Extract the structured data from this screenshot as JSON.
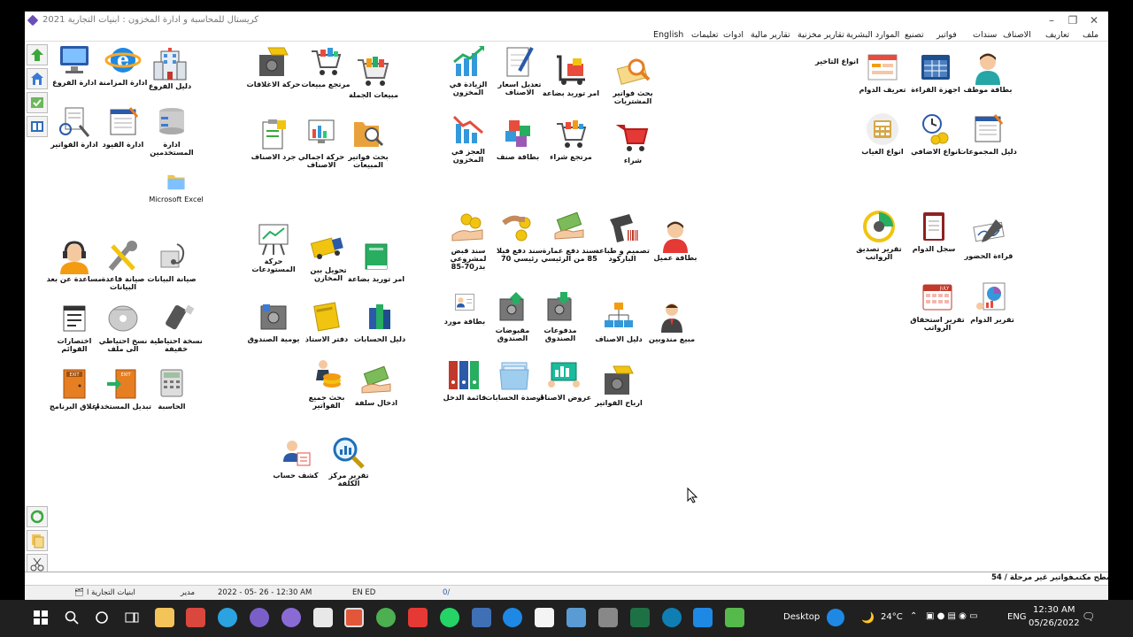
{
  "window": {
    "title": "كريستال للمحاسبة و ادارة المخزون : ابنيات التجارية 2021"
  },
  "menubar": {
    "items": [
      "ملف",
      "تعاريف",
      "الاصناف",
      "سندات",
      "فواتير",
      "تصنيع",
      "الموارد البشرية",
      "تقارير مخزنية",
      "تقارير مالية",
      "ادوات",
      "تعليمات",
      "English"
    ]
  },
  "shortcuts": {
    "admin": [
      {
        "label": "ادارة الفروع",
        "icon": "monitor-icon"
      },
      {
        "label": "ادارة المزامنة",
        "icon": "ie-icon"
      },
      {
        "label": "دليل الفروع",
        "icon": "building-icon"
      },
      {
        "label": "ادارة الفواتير",
        "icon": "invoice-tools-icon"
      },
      {
        "label": "ادارة القيود",
        "icon": "ledger-icon"
      },
      {
        "label": "ادارة المستخدمين",
        "icon": "users-db-icon"
      },
      {
        "label": "Microsoft Excel",
        "icon": "folder-icon"
      }
    ],
    "sales": [
      {
        "label": "حركة الاغلاقات",
        "icon": "safe-gold-icon"
      },
      {
        "label": "مرتجع مبيعات",
        "icon": "cart-return-icon"
      },
      {
        "label": "مبيعات الجملة",
        "icon": "cart-full-icon"
      },
      {
        "label": "جرد الاصناف",
        "icon": "clipboard-icon"
      },
      {
        "label": "حركة اجمالي الاصناف",
        "icon": "monitor-chart-icon"
      },
      {
        "label": "بحث فواتير المبيعات",
        "icon": "folder-search-icon"
      }
    ],
    "purchases": [
      {
        "label": "الزيادة في المخزون",
        "icon": "chart-up-icon"
      },
      {
        "label": "تعديل اسعار الاصناف",
        "icon": "pen-doc-icon"
      },
      {
        "label": "امر توريد بضاعة",
        "icon": "forklift-icon"
      },
      {
        "label": "بحث فواتير المشتريات",
        "icon": "search-doc-icon"
      },
      {
        "label": "العجز في المخزون",
        "icon": "chart-down-icon"
      },
      {
        "label": "بطاقة صنف",
        "icon": "cubes-icon"
      },
      {
        "label": "مرتجع شراء",
        "icon": "cart-return-icon"
      },
      {
        "label": "شراء",
        "icon": "cart-red-icon"
      }
    ],
    "hr": [
      {
        "label": "تعريف الدوام",
        "icon": "schedule-icon"
      },
      {
        "label": "اجهزة القراءة",
        "icon": "calendar-grid-icon"
      },
      {
        "label": "بطاقة موظف",
        "icon": "employee-icon"
      },
      {
        "label": "انواع الغياب",
        "icon": "calculator-icon"
      },
      {
        "label": "انواع الاضافي",
        "icon": "clock-coins-icon"
      },
      {
        "label": "دليل المجموعات",
        "icon": "ledger-icon"
      }
    ],
    "hr_label": "انواع التاخير",
    "maintenance": [
      {
        "label": "مساعدة عن بعد",
        "icon": "support-agent-icon"
      },
      {
        "label": "صيانة قاعدة البيانات",
        "icon": "wrench-icon"
      },
      {
        "label": "صيانة البيانات",
        "icon": "stethoscope-icon"
      },
      {
        "label": "اختصارات القوائم",
        "icon": "menu-shortcut-icon"
      },
      {
        "label": "نسخ احتياطي الى ملف",
        "icon": "disk-icon"
      },
      {
        "label": "نسخة احتياطية خفيفة",
        "icon": "usb-icon"
      },
      {
        "label": "اغلاق البرنامج",
        "icon": "exit-door-icon"
      },
      {
        "label": "تبديل المستخدم",
        "icon": "exit-switch-icon"
      },
      {
        "label": "الحاسبة",
        "icon": "calculator-icon"
      }
    ],
    "stock": [
      {
        "label": "حركة المستودعات",
        "icon": "easel-chart-icon"
      },
      {
        "label": "تحويل بين المخازن",
        "icon": "truck-icon"
      },
      {
        "label": "امر توريد بضاعة",
        "icon": "green-book-icon"
      },
      {
        "label": "يومية الصندوق",
        "icon": "safe-icon"
      },
      {
        "label": "دفتر الاستاذ",
        "icon": "yellow-book-icon"
      },
      {
        "label": "دليل الحسابات",
        "icon": "books-icon"
      },
      {
        "label": "بحث جميع الفواتير",
        "icon": "man-coins-icon"
      },
      {
        "label": "ادخال سلفة",
        "icon": "cash-hand-icon"
      },
      {
        "label": "كشف حساب",
        "icon": "account-card-icon"
      },
      {
        "label": "تقرير مركز الكلفة",
        "icon": "magnifier-chart-icon"
      }
    ],
    "vouchers": [
      {
        "label": "سند قبض لمشروعي بدر70-85",
        "icon": "coins-hand-icon"
      },
      {
        "label": "سند دفع فيلا رئيسي 70",
        "icon": "coins-hand-icon"
      },
      {
        "label": "سند دفع عمارة 85 من الرئيسي",
        "icon": "cash-hand-icon"
      },
      {
        "label": "تصميم و طباعة الباركود",
        "icon": "barcode-scanner-icon"
      },
      {
        "label": "بطاقة عميل",
        "icon": "customer-icon"
      },
      {
        "label": "بطاقة مورد",
        "icon": "supplier-card-icon"
      },
      {
        "label": "مقبوضات الصندوق",
        "icon": "safe-in-icon"
      },
      {
        "label": "مدفوعات الصندوق",
        "icon": "safe-out-icon"
      },
      {
        "label": "دليل الاصناف",
        "icon": "org-tree-icon"
      },
      {
        "label": "مبيع مندوبين",
        "icon": "salesman-icon"
      },
      {
        "label": "قائمة الدخل",
        "icon": "binders-icon"
      },
      {
        "label": "ارصدة الحسابات",
        "icon": "folders-icon"
      },
      {
        "label": "عروض الاصناف",
        "icon": "presentation-icon"
      },
      {
        "label": "ارباح الفواتير",
        "icon": "safe-gold-icon"
      }
    ],
    "reports": [
      {
        "label": "تقرير تصديق الرواتب",
        "icon": "pie-gauge-icon"
      },
      {
        "label": "سجل الدوام",
        "icon": "clipboard-red-icon"
      },
      {
        "label": "قراءة الحضور",
        "icon": "pen-sign-icon"
      },
      {
        "label": "تقرير استحقاق الرواتب",
        "icon": "calendar-july-icon"
      },
      {
        "label": "تقرير الدوام",
        "icon": "report-chart-icon"
      }
    ]
  },
  "bottom_tabs": {
    "desktop": "سطح مكتب",
    "unposted": "فواتير غير مرحلة / 54"
  },
  "status": {
    "company": "ابنيات التجارية ا",
    "user": "مدير",
    "datetime": "2022 - 05- 26 - 12:30 AM",
    "lang": "EN ED",
    "extra": "0/"
  },
  "taskbar": {
    "desktop_label": "Desktop",
    "temp": "24°C",
    "lang": "ENG",
    "time": "12:30 AM",
    "date": "05/26/2022"
  }
}
